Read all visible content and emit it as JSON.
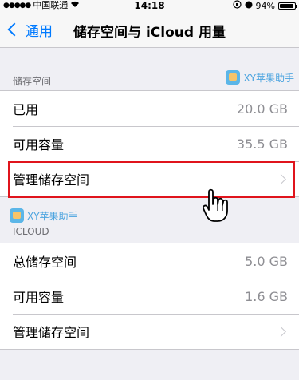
{
  "status_bar": {
    "carrier": "中国联通",
    "time": "14:18",
    "battery": "94%",
    "battery_level": 0.94
  },
  "nav": {
    "back_label": "通用",
    "title": "储存空间与 iCloud 用量"
  },
  "storage": {
    "header": "储存空间",
    "watermark": "XY苹果助手",
    "rows": [
      {
        "label": "已用",
        "value": "20.0 GB"
      },
      {
        "label": "可用容量",
        "value": "35.5 GB"
      },
      {
        "label": "管理储存空间",
        "value": ""
      }
    ]
  },
  "icloud": {
    "watermark": "XY苹果助手",
    "header": "ICLOUD",
    "rows": [
      {
        "label": "总储存空间",
        "value": "5.0 GB"
      },
      {
        "label": "可用容量",
        "value": "1.6 GB"
      },
      {
        "label": "管理储存空间",
        "value": ""
      }
    ]
  },
  "colors": {
    "accent": "#007aff",
    "highlight": "#e0141c"
  }
}
